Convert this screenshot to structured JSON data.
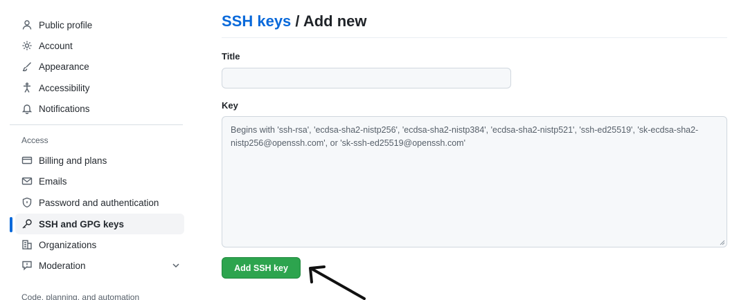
{
  "sidebar": {
    "items": [
      {
        "label": "Public profile",
        "icon": "person-icon"
      },
      {
        "label": "Account",
        "icon": "gear-icon"
      },
      {
        "label": "Appearance",
        "icon": "paintbrush-icon"
      },
      {
        "label": "Accessibility",
        "icon": "accessibility-icon"
      },
      {
        "label": "Notifications",
        "icon": "bell-icon"
      }
    ],
    "section_access": "Access",
    "access_items": [
      {
        "label": "Billing and plans",
        "icon": "credit-card-icon"
      },
      {
        "label": "Emails",
        "icon": "mail-icon"
      },
      {
        "label": "Password and authentication",
        "icon": "shield-lock-icon"
      },
      {
        "label": "SSH and GPG keys",
        "icon": "key-icon",
        "active": true
      },
      {
        "label": "Organizations",
        "icon": "organization-icon"
      },
      {
        "label": "Moderation",
        "icon": "report-icon"
      }
    ],
    "next_section": "Code, planning, and automation"
  },
  "main": {
    "breadcrumb_link": "SSH keys",
    "breadcrumb_separator": " / ",
    "breadcrumb_current": "Add new",
    "title_label": "Title",
    "title_value": "",
    "key_label": "Key",
    "key_placeholder": "Begins with 'ssh-rsa', 'ecdsa-sha2-nistp256', 'ecdsa-sha2-nistp384', 'ecdsa-sha2-nistp521', 'ssh-ed25519', 'sk-ecdsa-sha2-nistp256@openssh.com', or 'sk-ssh-ed25519@openssh.com'",
    "submit_label": "Add SSH key"
  },
  "colors": {
    "accent_link": "#0969da",
    "primary_button": "#2da44e",
    "active_indicator": "#0969da"
  }
}
